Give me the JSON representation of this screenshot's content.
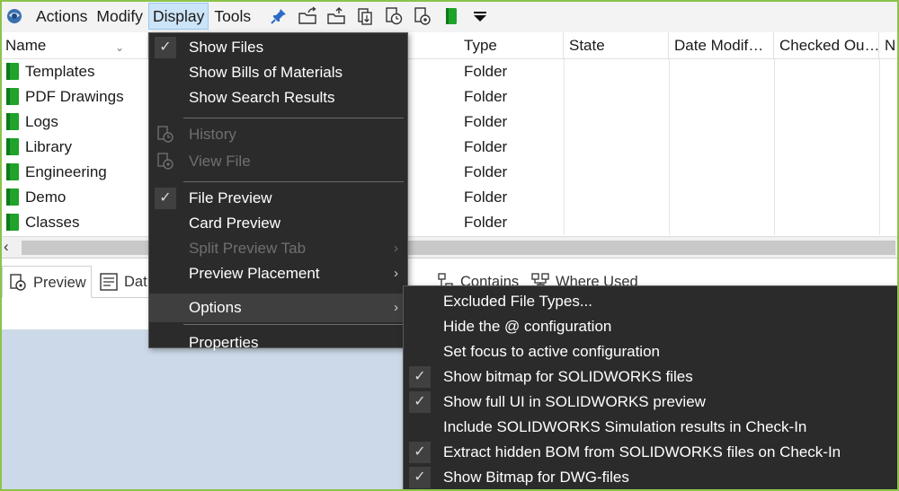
{
  "menubar": {
    "items": [
      "Actions",
      "Modify",
      "Display",
      "Tools"
    ],
    "active": "Display"
  },
  "columns": {
    "name": "Name",
    "type": "Type",
    "state": "State",
    "date_modified": "Date Modif…",
    "checked_out": "Checked Ou…",
    "overflow": "N"
  },
  "rows": [
    {
      "name": "Templates",
      "type": "Folder"
    },
    {
      "name": "PDF Drawings",
      "type": "Folder"
    },
    {
      "name": "Logs",
      "type": "Folder"
    },
    {
      "name": "Library",
      "type": "Folder"
    },
    {
      "name": "Engineering",
      "type": "Folder"
    },
    {
      "name": "Demo",
      "type": "Folder"
    },
    {
      "name": "Classes",
      "type": "Folder"
    }
  ],
  "tabs": {
    "preview": "Preview",
    "datacard": "Dat",
    "contains": "Contains",
    "where_used": "Where Used"
  },
  "display_menu": {
    "show_files": "Show Files",
    "show_bom": "Show Bills of Materials",
    "show_search": "Show Search Results",
    "history": "History",
    "view_file": "View File",
    "file_preview": "File Preview",
    "card_preview": "Card Preview",
    "split_preview_tab": "Split Preview Tab",
    "preview_placement": "Preview Placement",
    "options": "Options",
    "properties": "Properties"
  },
  "options_menu": {
    "excluded_file_types": "Excluded File Types...",
    "hide_config": "Hide the @ configuration",
    "set_focus": "Set focus to active configuration",
    "show_bitmap_sw": "Show bitmap for SOLIDWORKS files",
    "show_full_ui": "Show full UI in SOLIDWORKS preview",
    "include_simulation": "Include SOLIDWORKS Simulation results in Check-In",
    "extract_bom": "Extract hidden BOM from SOLIDWORKS files on Check-In",
    "show_bitmap_dwg": "Show Bitmap for DWG-files"
  },
  "colors": {
    "menu_bg": "#2b2b2b",
    "folder_green": "#1fa32a",
    "frame_green": "#8bc34a",
    "active_menu": "#cce4f7",
    "lower_pane": "#ccd9e8"
  },
  "icons": [
    "app-globe-icon",
    "pin-icon",
    "folder-share-icon",
    "folder-up-icon",
    "check-out-icon",
    "history-icon",
    "view-icon",
    "book-icon",
    "dropdown-arrow-icon"
  ]
}
